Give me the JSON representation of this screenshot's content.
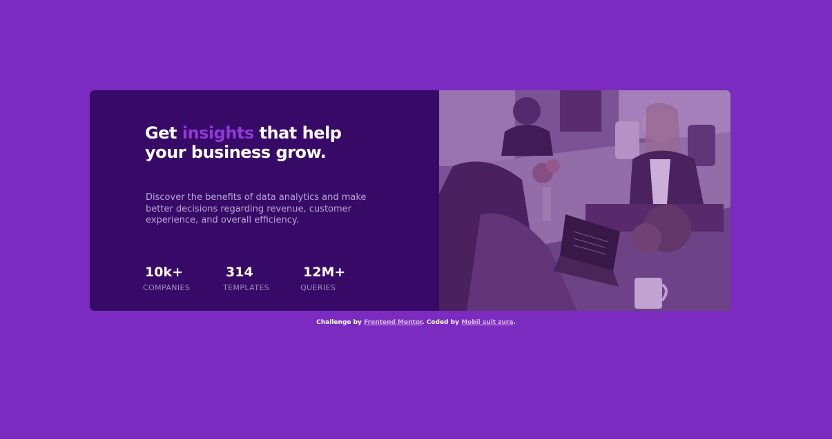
{
  "card": {
    "headline_before": "Get ",
    "headline_accent": "insights",
    "headline_after": " that help your business grow.",
    "description": "Discover the benefits of data analytics and make better decisions regarding revenue, customer experience, and overall efficiency.",
    "stats": [
      {
        "value": "10k+",
        "label": "COMPANIES"
      },
      {
        "value": "314",
        "label": "TEMPLATES"
      },
      {
        "value": "12M+",
        "label": "QUERIES"
      }
    ]
  },
  "attribution": {
    "prefix": "Challenge by ",
    "link1": "Frontend Mentor",
    "middle": ". Coded by ",
    "link2": "Mobil suit zura",
    "suffix": "."
  },
  "colors": {
    "page_bg": "#7b2bbf",
    "card_bg": "#380a68",
    "accent": "#8e3ad6"
  }
}
